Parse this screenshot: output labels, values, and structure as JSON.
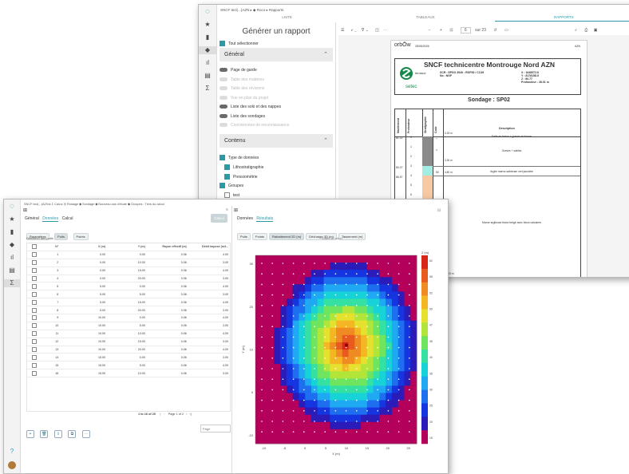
{
  "back_window": {
    "breadcrumb": [
      "SNCF tecl(...)AZN",
      "Roco",
      "Rapports"
    ],
    "tabs": [
      "LISTE",
      "TABLEAUX",
      "RAPPORTS"
    ],
    "panel_title": "Générer un rapport",
    "select_all_label": "Tout sélectionner",
    "section_general": "Général",
    "general_options": [
      {
        "label": "Page de garde",
        "enabled": true
      },
      {
        "label": "Table des matières",
        "enabled": false
      },
      {
        "label": "Table des révisions",
        "enabled": false
      },
      {
        "label": "Vue en plan du projet",
        "enabled": false
      },
      {
        "label": "Liste des sols et des nappes",
        "enabled": true
      },
      {
        "label": "Liste des sondages",
        "enabled": true
      },
      {
        "label": "Coordonnées de reconnaissance",
        "enabled": false
      }
    ],
    "section_content": "Contenu",
    "content_options": [
      {
        "label": "Type de données",
        "checked": true,
        "indent": false
      },
      {
        "label": "Lithostratigraphie",
        "checked": true,
        "indent": true
      },
      {
        "label": "Pressiométrie",
        "checked": true,
        "indent": true
      },
      {
        "label": "Groupes",
        "checked": true,
        "indent": false
      },
      {
        "label": "test",
        "checked": false,
        "indent": true
      }
    ],
    "viewer": {
      "page_number": "6",
      "page_total": "sur 23",
      "doc_logo": "orbŌw",
      "doc_date": "28/05/2026",
      "doc_header_right": "AZN",
      "report_title": "SNCF technicentre Montrouge Nord AZN",
      "brand1": "terrasol",
      "brand2": "setec",
      "scr_line1": "SCR : EPSG 3949 : RGF93 / CC49",
      "scr_line2": "No : NGF",
      "coord_x": "X : 1648572.6",
      "coord_y": "Y : 8178158.5",
      "coord_z": "Z : 80.77",
      "depth": "Profondeur : 28.01 m",
      "sondage": "Sondage : SP02",
      "col_headers": [
        "Nivellement",
        "Profondeur",
        "Stratigraphie",
        "Code",
        "Description"
      ],
      "levels": [
        "81.02",
        "80.07",
        "86.57"
      ],
      "depths": [
        "0",
        "1",
        "2",
        "3",
        "4",
        "5",
        "6",
        "7",
        "8"
      ],
      "layer_depths": [
        "0.25 m",
        "3.30 m",
        "4.80 m",
        "15.00 m"
      ],
      "layer_desc": [
        "Dalle en béton + graves et limons",
        "Graves + sables",
        "Argile marno-sableuse vert jaunâtre",
        "Marne argileuse blanc beigé avec blocs calcaires"
      ]
    }
  },
  "front_window": {
    "breadcrumb": "SNCF tecl(...)AZN  ▸  Σ Calc  ▸  ◎ Rostage ◆ Sondage ◆ Nouveau cas d'étude ◆ Groupes : Tiers du calcul",
    "left_tabs": [
      "Général",
      "Données",
      "Calcul"
    ],
    "calc_button": "Calcul",
    "sub_tabs": [
      "Paramètres",
      "Puits",
      "Points"
    ],
    "table_title": "Définition des puits",
    "table_headers": [
      "",
      "N°",
      "X (m)",
      "Y (m)",
      "Rayon effectif (m)",
      "Débit imposé (m3..."
    ],
    "rows": [
      [
        "1",
        "0.00",
        "0.00",
        "0.06",
        "4.00"
      ],
      [
        "2",
        "0.00",
        "10.00",
        "0.06",
        "3.00"
      ],
      [
        "3",
        "0.00",
        "15.00",
        "0.06",
        "4.00"
      ],
      [
        "4",
        "0.00",
        "20.00",
        "0.06",
        "3.00"
      ],
      [
        "5",
        "5.00",
        "0.00",
        "0.06",
        "4.00"
      ],
      [
        "6",
        "5.00",
        "5.00",
        "0.06",
        "3.00"
      ],
      [
        "7",
        "5.00",
        "15.00",
        "0.06",
        "4.00"
      ],
      [
        "8",
        "5.00",
        "20.00",
        "0.06",
        "3.00"
      ],
      [
        "9",
        "10.00",
        "0.00",
        "0.06",
        "4.00"
      ],
      [
        "10",
        "10.00",
        "5.00",
        "0.06",
        "3.00"
      ],
      [
        "11",
        "10.00",
        "10.00",
        "0.06",
        "4.00"
      ],
      [
        "12",
        "10.00",
        "15.00",
        "0.06",
        "3.00"
      ],
      [
        "13",
        "10.00",
        "20.00",
        "0.06",
        "4.00"
      ],
      [
        "14",
        "15.00",
        "0.00",
        "0.06",
        "3.00"
      ],
      [
        "15",
        "15.00",
        "5.00",
        "0.06",
        "4.00"
      ],
      [
        "16",
        "15.00",
        "10.00",
        "0.06",
        "3.00"
      ]
    ],
    "pagination": "1 to 16 of 20",
    "page_label": "Page 1 of 2",
    "page_input_placeholder": "Page",
    "right_tabs": [
      "Données",
      "Résultats"
    ],
    "result_tabs": [
      "Puits",
      "Points",
      "Rabattement 2D (m)",
      "Décharge 3D (m)",
      "Tassement (m)"
    ],
    "plot_caption": "Rosée de calcul",
    "colors": {
      "accent": "#2c9aa6"
    }
  },
  "chart_data": {
    "type": "heatmap",
    "title": "",
    "xlabel": "X (m)",
    "ylabel": "Y (m)",
    "x_ticks": [
      "-10",
      "-5",
      "0",
      "5",
      "10",
      "15",
      "20",
      "25"
    ],
    "y_ticks": [
      "-10",
      "0",
      "10",
      "20",
      "30"
    ],
    "xlim": [
      -12,
      27
    ],
    "ylim": [
      -12,
      32
    ],
    "colorbar_title": "Z (m)",
    "colorbar_ticks": [
      "62",
      "55",
      "52",
      "50",
      "47",
      "45",
      "40",
      "35",
      "30",
      "25",
      "20",
      "15"
    ],
    "peak": {
      "x": 10,
      "y": 11,
      "z": 62
    },
    "grid": true
  }
}
